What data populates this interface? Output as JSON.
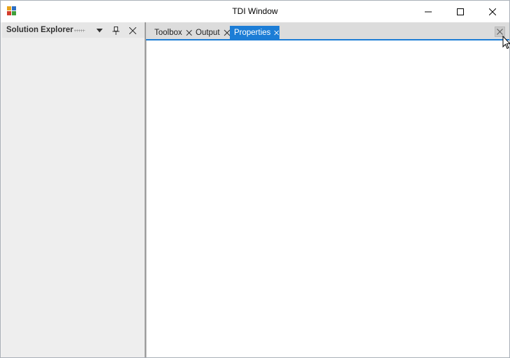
{
  "window": {
    "title": "TDI Window",
    "icon": "app-icon",
    "controls": {
      "minimize": "minimize-icon",
      "maximize": "maximize-icon",
      "close": "close-icon"
    }
  },
  "dock_panel": {
    "title": "Solution Explorer",
    "buttons": [
      "dropdown-icon",
      "pin-icon",
      "close-icon"
    ]
  },
  "tabs": [
    {
      "label": "Toolbox",
      "active": false
    },
    {
      "label": "Output",
      "active": false
    },
    {
      "label": "Properties",
      "active": true
    }
  ],
  "colors": {
    "accent": "#1c7dd6",
    "panel_bg": "#eeeeee",
    "tabstrip_bg": "#dcdcdc"
  }
}
